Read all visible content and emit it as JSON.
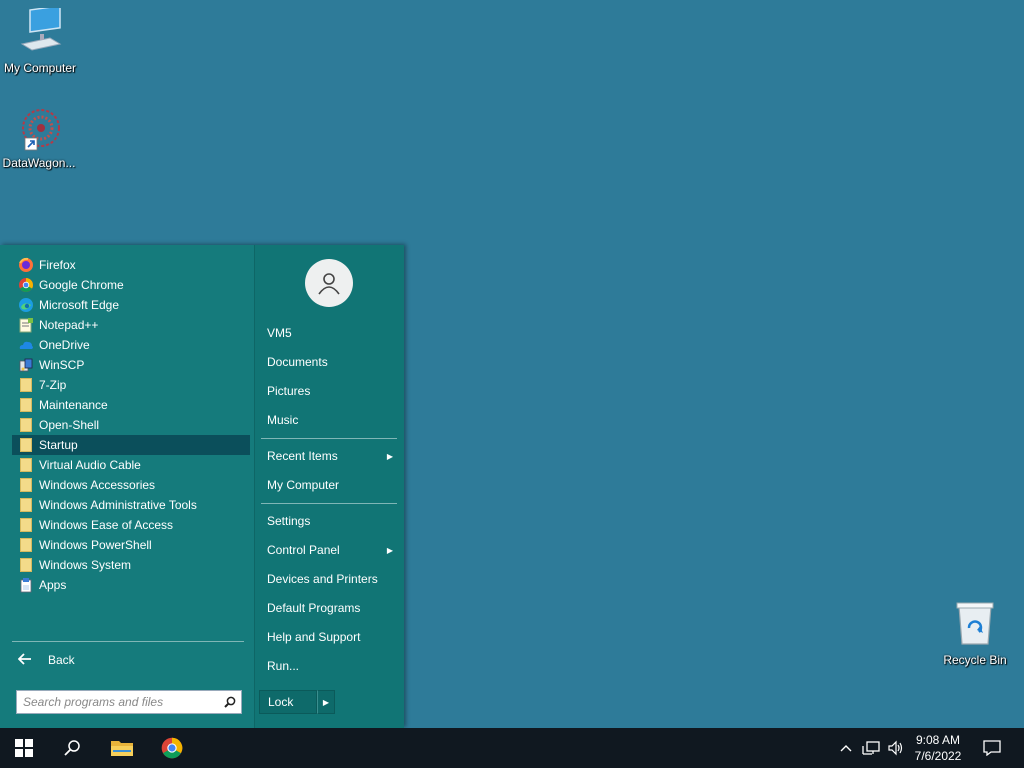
{
  "desktop": {
    "icons": [
      {
        "label": "My Computer"
      },
      {
        "label": "DataWagon..."
      },
      {
        "label": "Recycle Bin"
      }
    ]
  },
  "start_menu": {
    "programs": [
      {
        "label": "Firefox",
        "icon": "firefox-icon"
      },
      {
        "label": "Google Chrome",
        "icon": "chrome-icon"
      },
      {
        "label": "Microsoft Edge",
        "icon": "edge-icon"
      },
      {
        "label": "Notepad++",
        "icon": "notepad-plus-plus-icon"
      },
      {
        "label": "OneDrive",
        "icon": "onedrive-icon"
      },
      {
        "label": "WinSCP",
        "icon": "winscp-icon"
      },
      {
        "label": "7-Zip",
        "icon": "folder-icon"
      },
      {
        "label": "Maintenance",
        "icon": "folder-icon"
      },
      {
        "label": "Open-Shell",
        "icon": "folder-icon"
      },
      {
        "label": "Startup",
        "icon": "folder-icon",
        "selected": true
      },
      {
        "label": "Virtual Audio Cable",
        "icon": "folder-icon"
      },
      {
        "label": "Windows Accessories",
        "icon": "folder-icon"
      },
      {
        "label": "Windows Administrative Tools",
        "icon": "folder-icon"
      },
      {
        "label": "Windows Ease of Access",
        "icon": "folder-icon"
      },
      {
        "label": "Windows PowerShell",
        "icon": "folder-icon"
      },
      {
        "label": "Windows System",
        "icon": "folder-icon"
      },
      {
        "label": "Apps",
        "icon": "apps-icon"
      }
    ],
    "back_label": "Back",
    "search_placeholder": "Search programs and files",
    "right": {
      "user": "VM5",
      "documents": "Documents",
      "pictures": "Pictures",
      "music": "Music",
      "recent_items": "Recent Items",
      "my_computer": "My Computer",
      "settings": "Settings",
      "control_panel": "Control Panel",
      "devices_printers": "Devices and Printers",
      "default_programs": "Default Programs",
      "help_support": "Help and Support",
      "run": "Run...",
      "lock": "Lock"
    }
  },
  "taskbar": {
    "time": "9:08 AM",
    "date": "7/6/2022"
  },
  "colors": {
    "desktop": "#2e7b99",
    "menu": "#157b7c",
    "selected": "#0b4f5b",
    "taskbar": "#101820"
  }
}
